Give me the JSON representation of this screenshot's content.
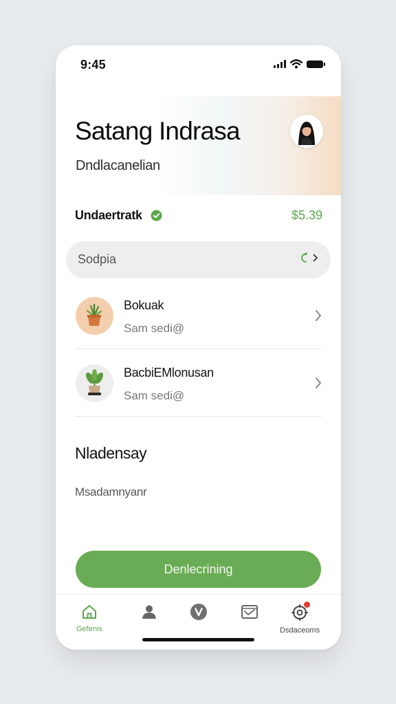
{
  "status": {
    "time": "9:45"
  },
  "profile": {
    "name": "Satang Indrasa",
    "subtitle": "Dndlacanelian"
  },
  "balance": {
    "label": "Undaertratk",
    "amount": "$5.39"
  },
  "search": {
    "placeholder": "Sodpia",
    "action": "{ >"
  },
  "items": [
    {
      "title": "Bokuak",
      "subtitle": "Sam sedi@",
      "icon": "potted-plant-icon"
    },
    {
      "title": "BacbiEMlonusan",
      "subtitle": "Sam sedi@",
      "icon": "sprout-pot-icon"
    }
  ],
  "section": {
    "title": "Nladensay",
    "subtitle": "Msadamnyanr"
  },
  "primary_button": {
    "label": "Denlecrining"
  },
  "tabs": [
    {
      "label": "Gefenis",
      "icon": "home-icon",
      "active": true
    },
    {
      "label": "",
      "icon": "person-icon",
      "active": false
    },
    {
      "label": "",
      "icon": "v-circle-icon",
      "active": false
    },
    {
      "label": "",
      "icon": "inbox-icon",
      "active": false
    },
    {
      "label": "Dsdaceoms",
      "icon": "settings-icon",
      "active": false
    }
  ],
  "colors": {
    "accent": "#6aac55",
    "avatar_bg": "#f4cfae",
    "notification": "#e53935"
  }
}
